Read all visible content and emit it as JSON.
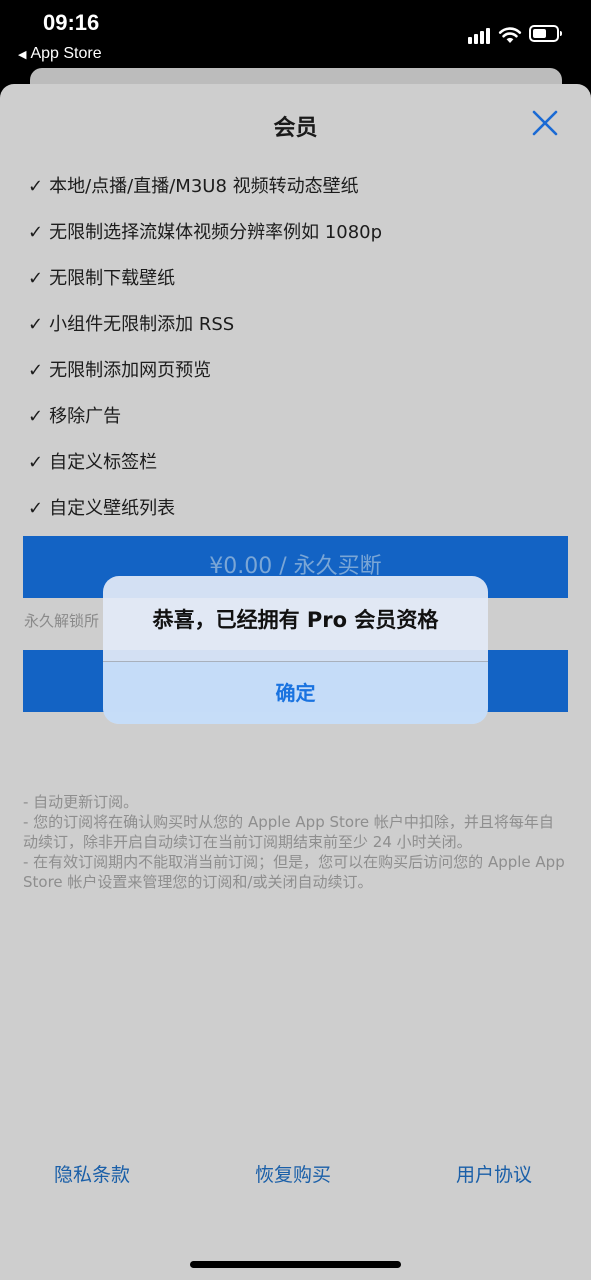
{
  "status_bar": {
    "time": "09:16",
    "back_label": "App Store",
    "back_arrow": "◀"
  },
  "sheet": {
    "title": "会员",
    "close_icon": "close-icon",
    "features": [
      "本地/点播/直播/M3U8 视频转动态壁纸",
      "无限制选择流媒体视频分辨率例如 1080p",
      "无限制下载壁纸",
      "小组件无限制添加 RSS",
      "无限制添加网页预览",
      "移除广告",
      "自定义标签栏",
      "自定义壁纸列表"
    ],
    "check_mark": "✓",
    "buy_button_label": "¥0.00 / 永久买断",
    "buy_caption": "永久解锁所",
    "terms": [
      "- 自动更新订阅。",
      "- 您的订阅将在确认购买时从您的 Apple App Store 帐户中扣除，并且将每年自动续订，除非开启自动续订在当前订阅期结束前至少 24 小时关闭。",
      "- 在有效订阅期内不能取消当前订阅；但是，您可以在购买后访问您的 Apple App Store 帐户设置来管理您的订阅和/或关闭自动续订。"
    ]
  },
  "footer": {
    "privacy": "隐私条款",
    "restore": "恢复购买",
    "agreement": "用户协议"
  },
  "alert": {
    "message": "恭喜，已经拥有 Pro 会员资格",
    "confirm": "确定"
  },
  "colors": {
    "accent": "#1363c4",
    "alert_button_text": "#1a73e0",
    "link": "#1a5fa8"
  }
}
